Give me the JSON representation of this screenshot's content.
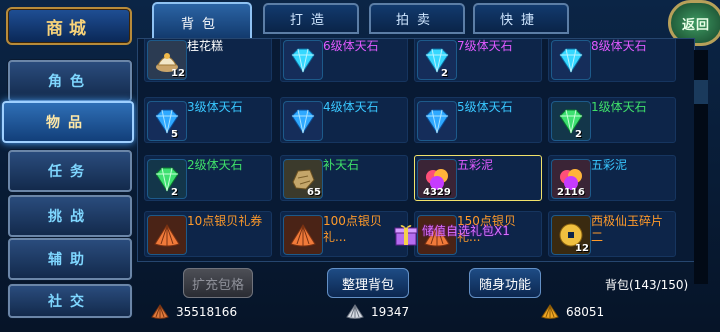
{
  "sidebar": {
    "title": "商城",
    "items": [
      {
        "label": "角色"
      },
      {
        "label": "物品"
      },
      {
        "label": "任务"
      },
      {
        "label": "挑战"
      },
      {
        "label": "辅助"
      },
      {
        "label": "社交"
      }
    ]
  },
  "tabs": [
    {
      "label": "背包"
    },
    {
      "label": "打造"
    },
    {
      "label": "拍卖"
    },
    {
      "label": "快捷"
    }
  ],
  "return_label": "返回",
  "items": [
    {
      "name": "桂花糕",
      "count": "12",
      "color": "#ffffff"
    },
    {
      "name": "6级体天石",
      "count": "",
      "color": "#e05aff"
    },
    {
      "name": "7级体天石",
      "count": "2",
      "color": "#e05aff"
    },
    {
      "name": "8级体天石",
      "count": "",
      "color": "#e05aff"
    },
    {
      "name": "3级体天石",
      "count": "5",
      "color": "#39c7ff"
    },
    {
      "name": "4级体天石",
      "count": "",
      "color": "#39c7ff"
    },
    {
      "name": "5级体天石",
      "count": "",
      "color": "#39c7ff"
    },
    {
      "name": "1级体天石",
      "count": "2",
      "color": "#3fe06a"
    },
    {
      "name": "2级体天石",
      "count": "2",
      "color": "#3fe06a"
    },
    {
      "name": "补天石",
      "count": "65",
      "color": "#3fe06a"
    },
    {
      "name": "五彩泥",
      "count": "4329",
      "color": "#e05aff"
    },
    {
      "name": "五彩泥",
      "count": "2116",
      "color": "#39c7ff"
    },
    {
      "name": "10点银贝礼券",
      "count": "",
      "color": "#ff9a2a"
    },
    {
      "name": "100点银贝礼...",
      "count": "",
      "color": "#ff9a2a"
    },
    {
      "name": "150点银贝礼...",
      "count": "",
      "color": "#ff9a2a"
    },
    {
      "name": "西极仙玉碎片二",
      "count": "12",
      "color": "#ff9a2a"
    }
  ],
  "overlay_text": "储值自选礼包X1",
  "buttons": {
    "expand": "扩充包格",
    "sort": "整理背包",
    "portable": "随身功能"
  },
  "bag_count": "背包(143/150)",
  "currency": {
    "copper": "35518166",
    "silver": "19347",
    "gold": "68051"
  }
}
